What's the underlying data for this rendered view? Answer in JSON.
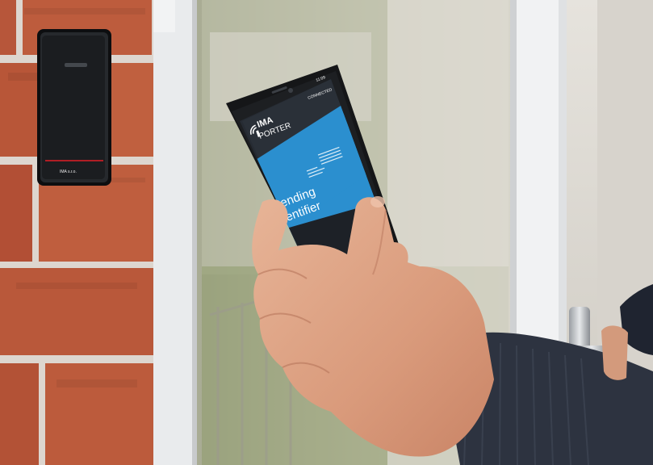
{
  "phone_app": {
    "brand_line1": "IMA",
    "brand_line2": "PORTER",
    "status_line1": "Sending",
    "status_line2": "identifier",
    "top_right_text": "CONNECTED",
    "status_bar_time": "11:09"
  },
  "reader": {
    "logo_text": "IMA s.r.o."
  },
  "colors": {
    "brick": "#b9573a",
    "mortar": "#e3ddd7",
    "screen_blue": "#2b8fcf",
    "phone_body": "#151618",
    "sweater": "#2f3542",
    "skin": "#e0a98a"
  },
  "icons": {
    "app_logo": "wireless-tag-icon",
    "nfc": "nfc-icon"
  }
}
